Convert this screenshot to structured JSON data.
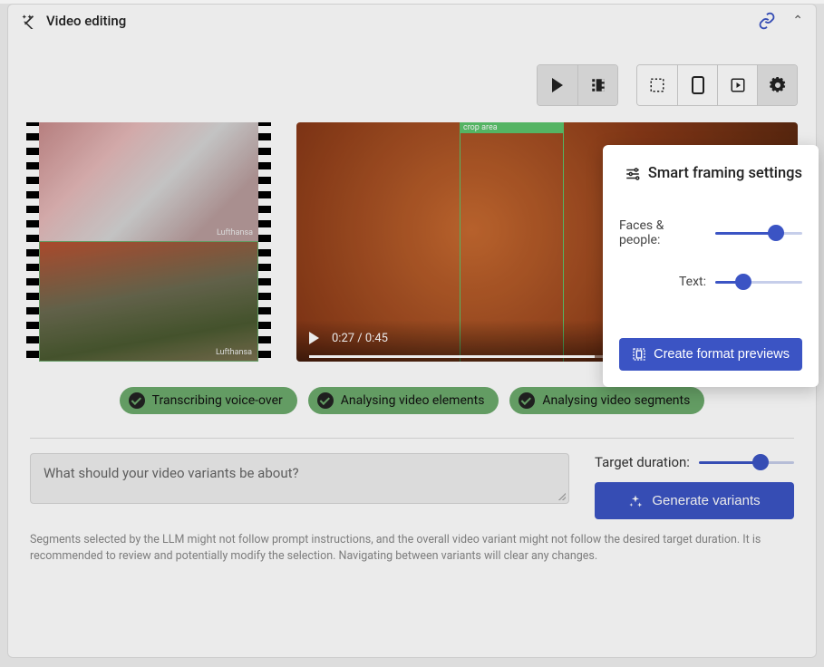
{
  "header": {
    "title": "Video editing"
  },
  "toolbar": {
    "play_label": "Play",
    "film_label": "Film strip",
    "select_label": "Select area",
    "mobile_label": "Mobile preview",
    "preview_label": "Square preview",
    "settings_label": "Settings"
  },
  "filmstrip": {
    "brand1": "Lufthansa",
    "brand2": "Lufthansa"
  },
  "video": {
    "crop_label": "crop area",
    "timecode": "0:27 / 0:45"
  },
  "status": {
    "items": [
      "Transcribing voice-over",
      "Analysing video elements",
      "Analysing video segments"
    ]
  },
  "prompt": {
    "placeholder": "What should your video variants be about?"
  },
  "target": {
    "label": "Target duration:",
    "value_pct": 65
  },
  "generate": {
    "label": "Generate variants"
  },
  "disclaimer": "Segments selected by the LLM might not follow prompt instructions, and the overall video variant might not follow the desired target duration. It is recommended to review and potentially modify the selection. Navigating between variants will clear any changes.",
  "popover": {
    "title": "Smart framing settings",
    "rows": [
      {
        "label": "Faces & people:",
        "value_pct": 70
      },
      {
        "label": "Text:",
        "value_pct": 32
      }
    ],
    "button": "Create format previews"
  }
}
